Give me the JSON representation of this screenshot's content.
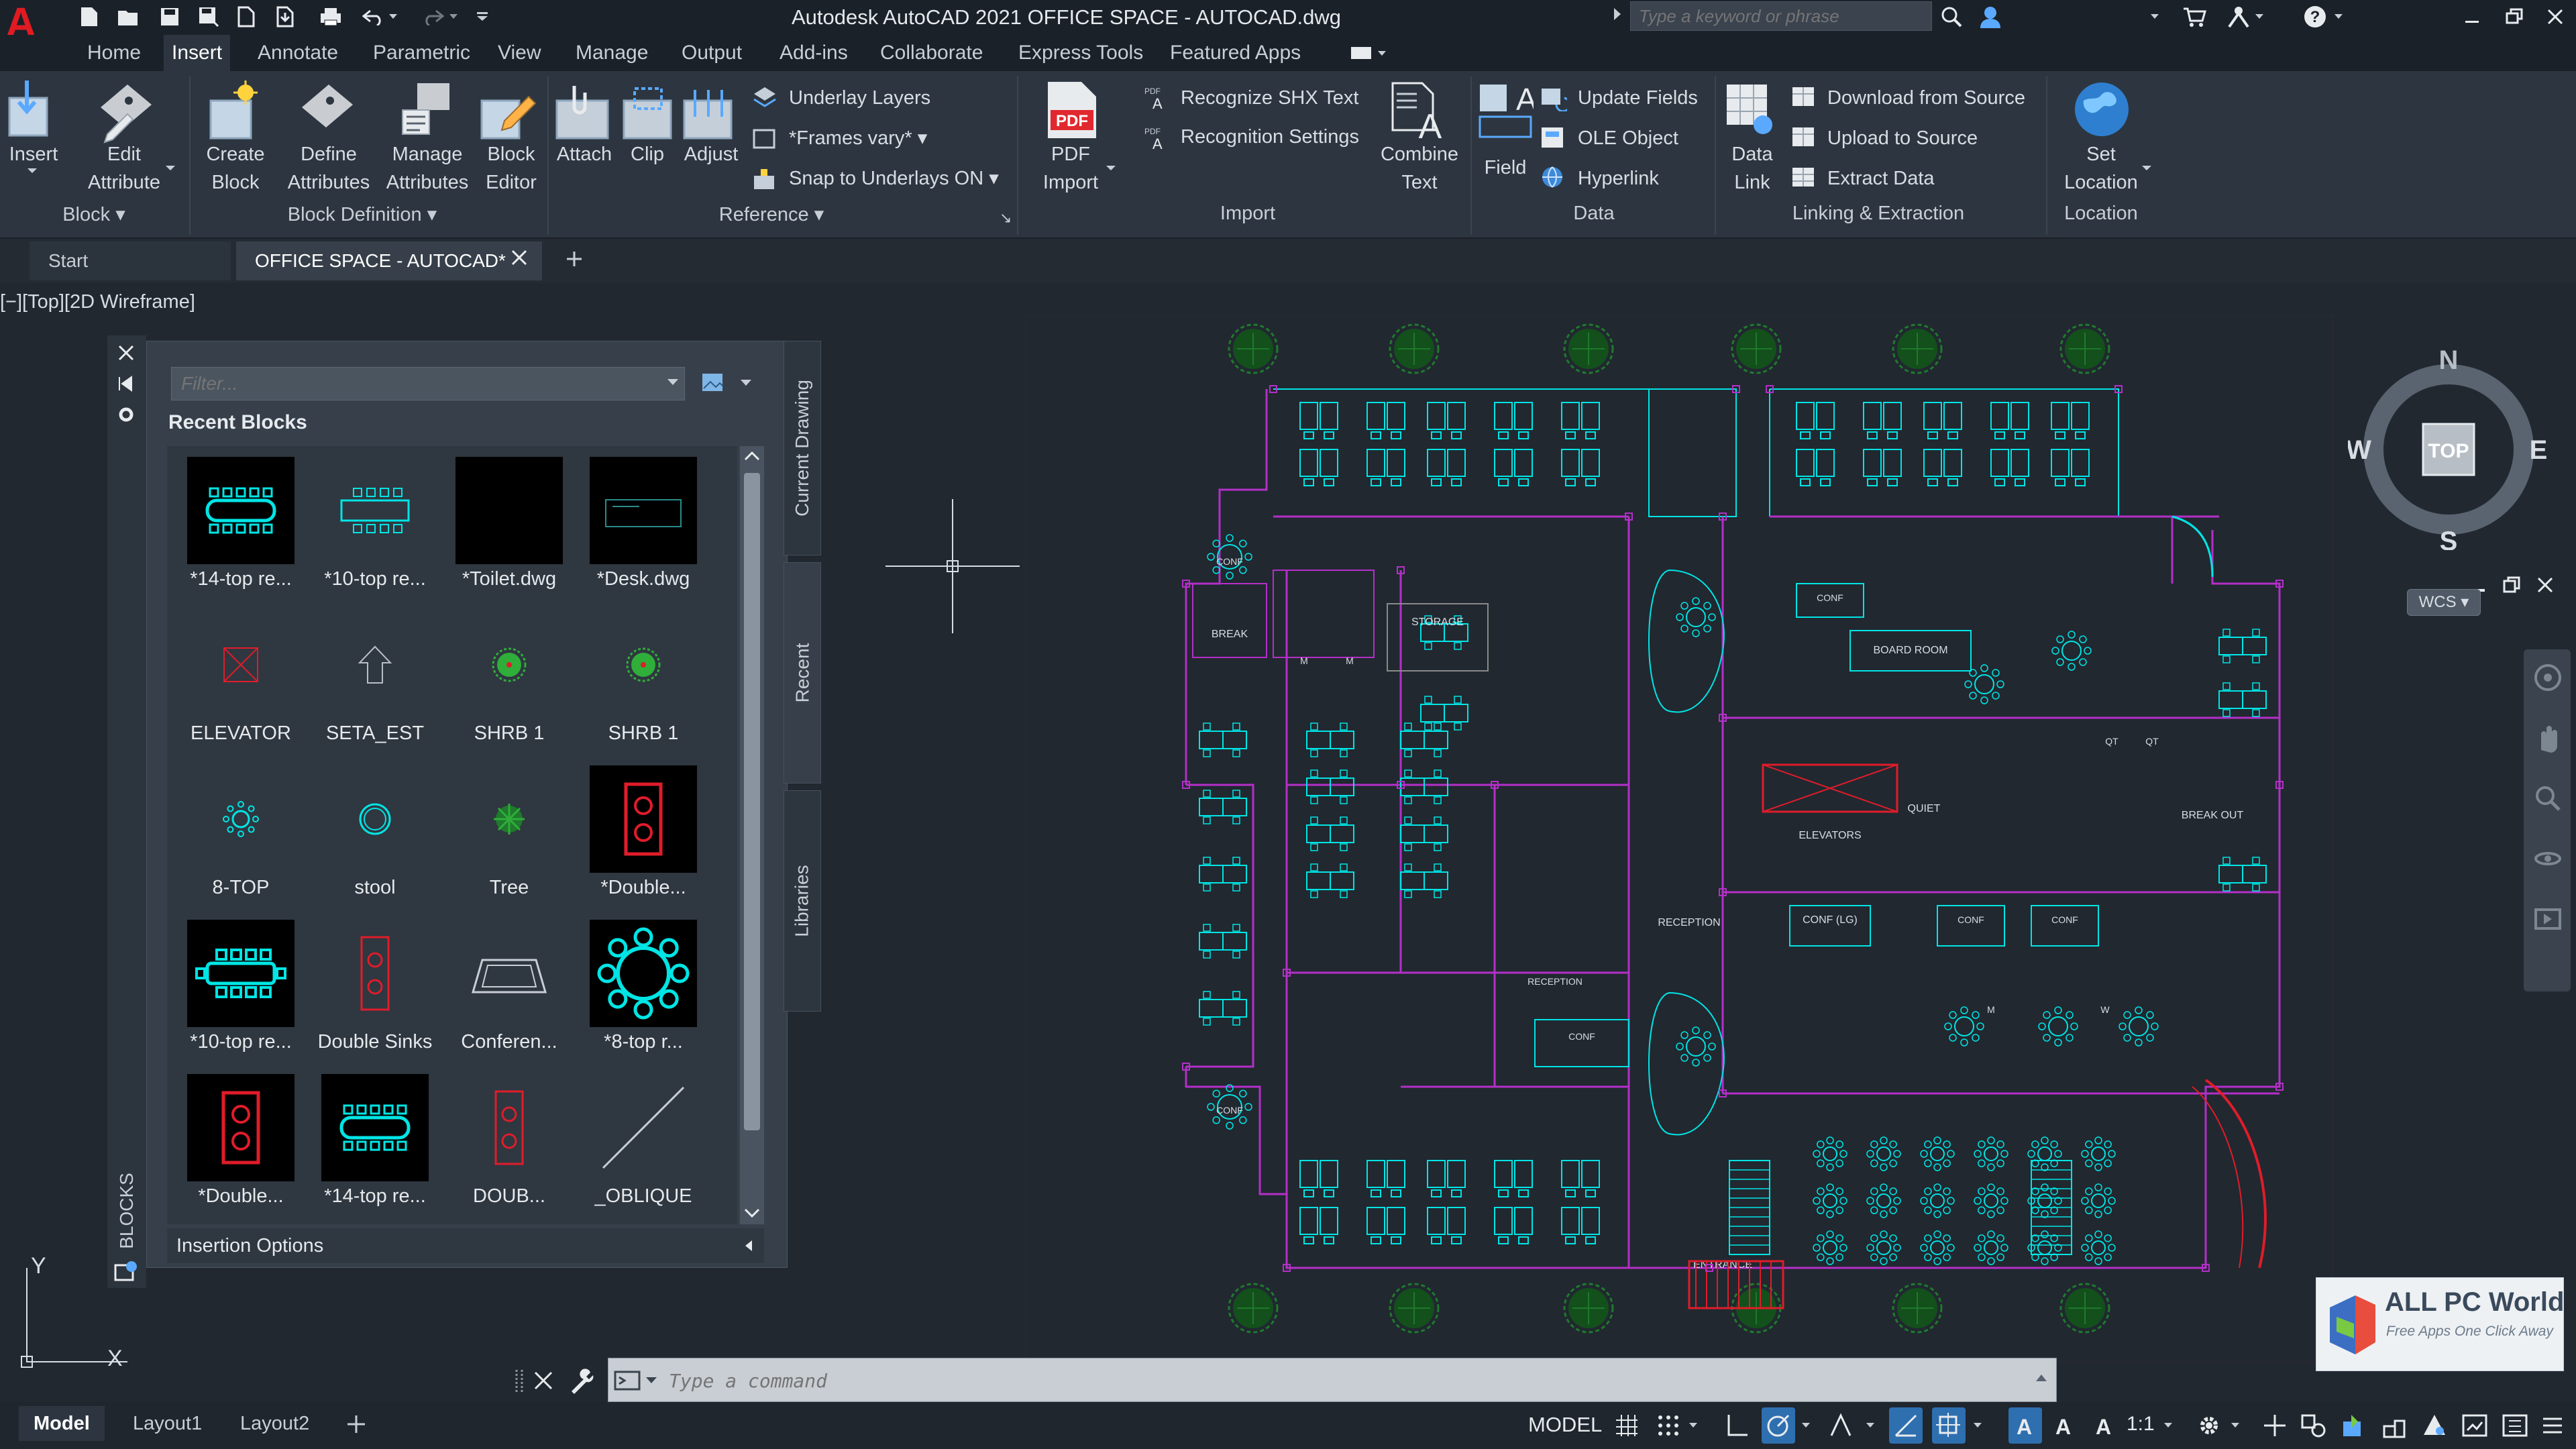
{
  "titlebar": {
    "app_title": "Autodesk AutoCAD 2021    OFFICE SPACE - AUTOCAD.dwg",
    "search_placeholder": "Type a keyword or phrase"
  },
  "menu": {
    "tabs": [
      "Home",
      "Insert",
      "Annotate",
      "Parametric",
      "View",
      "Manage",
      "Output",
      "Add-ins",
      "Collaborate",
      "Express Tools",
      "Featured Apps"
    ],
    "active": "Insert"
  },
  "ribbon": {
    "block": {
      "insert": "Insert",
      "edit_attribute_1": "Edit",
      "edit_attribute_2": "Attribute",
      "title": "Block"
    },
    "block_definition": {
      "create_1": "Create",
      "create_2": "Block",
      "define_1": "Define",
      "define_2": "Attributes",
      "manage_1": "Manage",
      "manage_2": "Attributes",
      "editor_1": "Block",
      "editor_2": "Editor",
      "title": "Block Definition"
    },
    "reference": {
      "attach": "Attach",
      "clip": "Clip",
      "adjust": "Adjust",
      "underlay_layers": "Underlay Layers",
      "frames_vary": "*Frames vary*",
      "snap_underlays": "Snap to Underlays ON",
      "title": "Reference"
    },
    "import": {
      "pdf_1": "PDF",
      "pdf_2": "Import",
      "recognize_shx": "Recognize SHX Text",
      "recognition_settings": "Recognition Settings",
      "combine_1": "Combine",
      "combine_2": "Text",
      "title": "Import"
    },
    "data": {
      "field": "Field",
      "update_fields": "Update Fields",
      "ole_object": "OLE Object",
      "hyperlink": "Hyperlink",
      "title": "Data"
    },
    "linking": {
      "data_link_1": "Data",
      "data_link_2": "Link",
      "download": "Download from Source",
      "upload": "Upload to Source",
      "extract": "Extract  Data",
      "title": "Linking & Extraction"
    },
    "location": {
      "set_1": "Set",
      "set_2": "Location",
      "title": "Location"
    }
  },
  "doctabs": {
    "start": "Start",
    "file": "OFFICE SPACE - AUTOCAD*"
  },
  "viewport": {
    "label": "[−][Top][2D Wireframe]"
  },
  "palette": {
    "filter_placeholder": "Filter...",
    "recent_title": "Recent Blocks",
    "side_tabs": [
      "Current Drawing",
      "Recent",
      "Libraries"
    ],
    "vertical_title": "BLOCKS",
    "insertion_options": "Insertion Options",
    "blocks": [
      {
        "name": "*14-top re...",
        "thumb": "table14",
        "dark": true
      },
      {
        "name": "*10-top re...",
        "thumb": "table10",
        "dark": false
      },
      {
        "name": "*Toilet.dwg",
        "thumb": "blank",
        "dark": true
      },
      {
        "name": "*Desk.dwg",
        "thumb": "desk",
        "dark": true
      },
      {
        "name": "ELEVATOR",
        "thumb": "elevator",
        "dark": false
      },
      {
        "name": "SETA_EST",
        "thumb": "arrow",
        "dark": false
      },
      {
        "name": "SHRB 1",
        "thumb": "shrub",
        "dark": false
      },
      {
        "name": "SHRB 1",
        "thumb": "shrub",
        "dark": false
      },
      {
        "name": "8-TOP",
        "thumb": "small8",
        "dark": false
      },
      {
        "name": "stool",
        "thumb": "stool",
        "dark": false
      },
      {
        "name": "Tree",
        "thumb": "tree",
        "dark": false
      },
      {
        "name": "*Double...",
        "thumb": "sink",
        "dark": true
      },
      {
        "name": "*10-top re...",
        "thumb": "table10b",
        "dark": true
      },
      {
        "name": "Double Sinks",
        "thumb": "sink2",
        "dark": false
      },
      {
        "name": "Conferen...",
        "thumb": "conf",
        "dark": false
      },
      {
        "name": "*8-top r...",
        "thumb": "round8",
        "dark": true
      },
      {
        "name": "*Double...",
        "thumb": "sink",
        "dark": true
      },
      {
        "name": "*14-top re...",
        "thumb": "table14",
        "dark": true
      },
      {
        "name": "DOUB...",
        "thumb": "sink2",
        "dark": false
      },
      {
        "name": "_OBLIQUE",
        "thumb": "oblique",
        "dark": false
      }
    ]
  },
  "drawing_labels": {
    "storage": "STORAGE",
    "break": "BREAK",
    "board_room": "BOARD ROOM",
    "conf": "CONF",
    "elevators": "ELEVATORS",
    "quiet": "QUIET",
    "break_out": "BREAK OUT",
    "reception": "RECEPTION",
    "conf_lg": "CONF (LG)",
    "entrance": "ENTRANCE",
    "qt": "QT",
    "m": "M",
    "w": "W"
  },
  "viewcube": {
    "n": "N",
    "s": "S",
    "e": "E",
    "w": "W",
    "face": "TOP",
    "wcs": "WCS"
  },
  "watermark": {
    "title": "ALL PC World",
    "subtitle": "Free Apps One Click Away"
  },
  "command": {
    "placeholder": "Type a command"
  },
  "statusbar": {
    "layouts": [
      "Model",
      "Layout1",
      "Layout2"
    ],
    "model": "MODEL",
    "scale": "1:1"
  },
  "colors": {
    "cyan": "#00e5e5",
    "magenta": "#b42fc8",
    "green": "#2fae3a",
    "red": "#e01c2a",
    "accent": "#1e90e0"
  }
}
